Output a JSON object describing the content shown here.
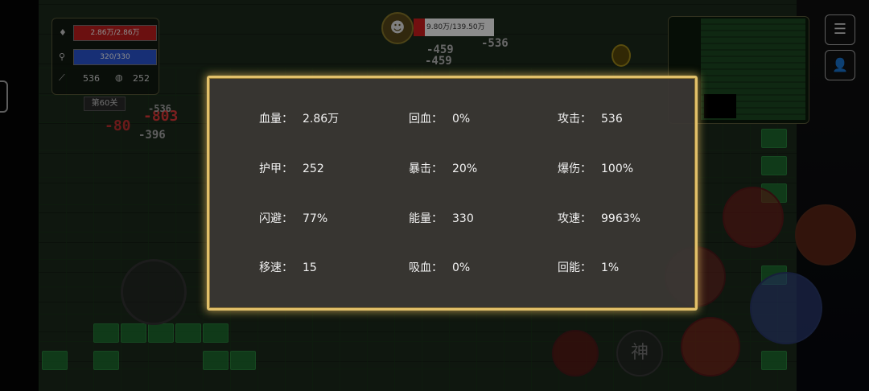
{
  "player": {
    "hp_text": "2.86万/2.86万",
    "mp_text": "320/330",
    "attack": "536",
    "armor": "252",
    "level": "第60关"
  },
  "boss": {
    "hp_text": "9.80万/139.50万"
  },
  "damage_numbers": [
    "-459",
    "-459",
    "-536",
    "-803",
    "-80",
    "-396",
    "-536"
  ],
  "buttons": {
    "menu_glyph": "☰",
    "profile_glyph": "👤",
    "skill_god": "神"
  },
  "stats_panel": {
    "items": [
      {
        "label": "血量：",
        "value": "2.86万"
      },
      {
        "label": "回血：",
        "value": "0%"
      },
      {
        "label": "攻击：",
        "value": "536"
      },
      {
        "label": "护甲：",
        "value": "252"
      },
      {
        "label": "暴击：",
        "value": "20%"
      },
      {
        "label": "爆伤：",
        "value": "100%"
      },
      {
        "label": "闪避：",
        "value": "77%"
      },
      {
        "label": "能量：",
        "value": "330"
      },
      {
        "label": "攻速：",
        "value": "9963%"
      },
      {
        "label": "移速：",
        "value": "15"
      },
      {
        "label": "吸血：",
        "value": "0%"
      },
      {
        "label": "回能：",
        "value": "1%"
      }
    ]
  },
  "colors": {
    "modal_border": "#e2c06a",
    "hp_red": "#c41e1e",
    "mp_blue": "#2a56d6",
    "damage_red": "#e23a3a"
  }
}
